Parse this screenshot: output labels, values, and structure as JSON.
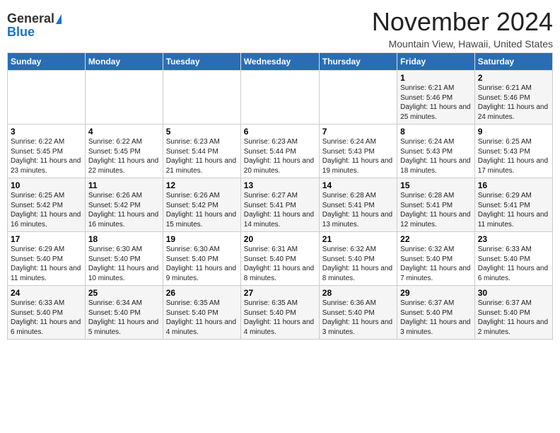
{
  "logo": {
    "general": "General",
    "blue": "Blue"
  },
  "header": {
    "month": "November 2024",
    "location": "Mountain View, Hawaii, United States"
  },
  "weekdays": [
    "Sunday",
    "Monday",
    "Tuesday",
    "Wednesday",
    "Thursday",
    "Friday",
    "Saturday"
  ],
  "weeks": [
    [
      {
        "day": "",
        "info": ""
      },
      {
        "day": "",
        "info": ""
      },
      {
        "day": "",
        "info": ""
      },
      {
        "day": "",
        "info": ""
      },
      {
        "day": "",
        "info": ""
      },
      {
        "day": "1",
        "info": "Sunrise: 6:21 AM\nSunset: 5:46 PM\nDaylight: 11 hours and 25 minutes."
      },
      {
        "day": "2",
        "info": "Sunrise: 6:21 AM\nSunset: 5:46 PM\nDaylight: 11 hours and 24 minutes."
      }
    ],
    [
      {
        "day": "3",
        "info": "Sunrise: 6:22 AM\nSunset: 5:45 PM\nDaylight: 11 hours and 23 minutes."
      },
      {
        "day": "4",
        "info": "Sunrise: 6:22 AM\nSunset: 5:45 PM\nDaylight: 11 hours and 22 minutes."
      },
      {
        "day": "5",
        "info": "Sunrise: 6:23 AM\nSunset: 5:44 PM\nDaylight: 11 hours and 21 minutes."
      },
      {
        "day": "6",
        "info": "Sunrise: 6:23 AM\nSunset: 5:44 PM\nDaylight: 11 hours and 20 minutes."
      },
      {
        "day": "7",
        "info": "Sunrise: 6:24 AM\nSunset: 5:43 PM\nDaylight: 11 hours and 19 minutes."
      },
      {
        "day": "8",
        "info": "Sunrise: 6:24 AM\nSunset: 5:43 PM\nDaylight: 11 hours and 18 minutes."
      },
      {
        "day": "9",
        "info": "Sunrise: 6:25 AM\nSunset: 5:43 PM\nDaylight: 11 hours and 17 minutes."
      }
    ],
    [
      {
        "day": "10",
        "info": "Sunrise: 6:25 AM\nSunset: 5:42 PM\nDaylight: 11 hours and 16 minutes."
      },
      {
        "day": "11",
        "info": "Sunrise: 6:26 AM\nSunset: 5:42 PM\nDaylight: 11 hours and 16 minutes."
      },
      {
        "day": "12",
        "info": "Sunrise: 6:26 AM\nSunset: 5:42 PM\nDaylight: 11 hours and 15 minutes."
      },
      {
        "day": "13",
        "info": "Sunrise: 6:27 AM\nSunset: 5:41 PM\nDaylight: 11 hours and 14 minutes."
      },
      {
        "day": "14",
        "info": "Sunrise: 6:28 AM\nSunset: 5:41 PM\nDaylight: 11 hours and 13 minutes."
      },
      {
        "day": "15",
        "info": "Sunrise: 6:28 AM\nSunset: 5:41 PM\nDaylight: 11 hours and 12 minutes."
      },
      {
        "day": "16",
        "info": "Sunrise: 6:29 AM\nSunset: 5:41 PM\nDaylight: 11 hours and 11 minutes."
      }
    ],
    [
      {
        "day": "17",
        "info": "Sunrise: 6:29 AM\nSunset: 5:40 PM\nDaylight: 11 hours and 11 minutes."
      },
      {
        "day": "18",
        "info": "Sunrise: 6:30 AM\nSunset: 5:40 PM\nDaylight: 11 hours and 10 minutes."
      },
      {
        "day": "19",
        "info": "Sunrise: 6:30 AM\nSunset: 5:40 PM\nDaylight: 11 hours and 9 minutes."
      },
      {
        "day": "20",
        "info": "Sunrise: 6:31 AM\nSunset: 5:40 PM\nDaylight: 11 hours and 8 minutes."
      },
      {
        "day": "21",
        "info": "Sunrise: 6:32 AM\nSunset: 5:40 PM\nDaylight: 11 hours and 8 minutes."
      },
      {
        "day": "22",
        "info": "Sunrise: 6:32 AM\nSunset: 5:40 PM\nDaylight: 11 hours and 7 minutes."
      },
      {
        "day": "23",
        "info": "Sunrise: 6:33 AM\nSunset: 5:40 PM\nDaylight: 11 hours and 6 minutes."
      }
    ],
    [
      {
        "day": "24",
        "info": "Sunrise: 6:33 AM\nSunset: 5:40 PM\nDaylight: 11 hours and 6 minutes."
      },
      {
        "day": "25",
        "info": "Sunrise: 6:34 AM\nSunset: 5:40 PM\nDaylight: 11 hours and 5 minutes."
      },
      {
        "day": "26",
        "info": "Sunrise: 6:35 AM\nSunset: 5:40 PM\nDaylight: 11 hours and 4 minutes."
      },
      {
        "day": "27",
        "info": "Sunrise: 6:35 AM\nSunset: 5:40 PM\nDaylight: 11 hours and 4 minutes."
      },
      {
        "day": "28",
        "info": "Sunrise: 6:36 AM\nSunset: 5:40 PM\nDaylight: 11 hours and 3 minutes."
      },
      {
        "day": "29",
        "info": "Sunrise: 6:37 AM\nSunset: 5:40 PM\nDaylight: 11 hours and 3 minutes."
      },
      {
        "day": "30",
        "info": "Sunrise: 6:37 AM\nSunset: 5:40 PM\nDaylight: 11 hours and 2 minutes."
      }
    ]
  ]
}
